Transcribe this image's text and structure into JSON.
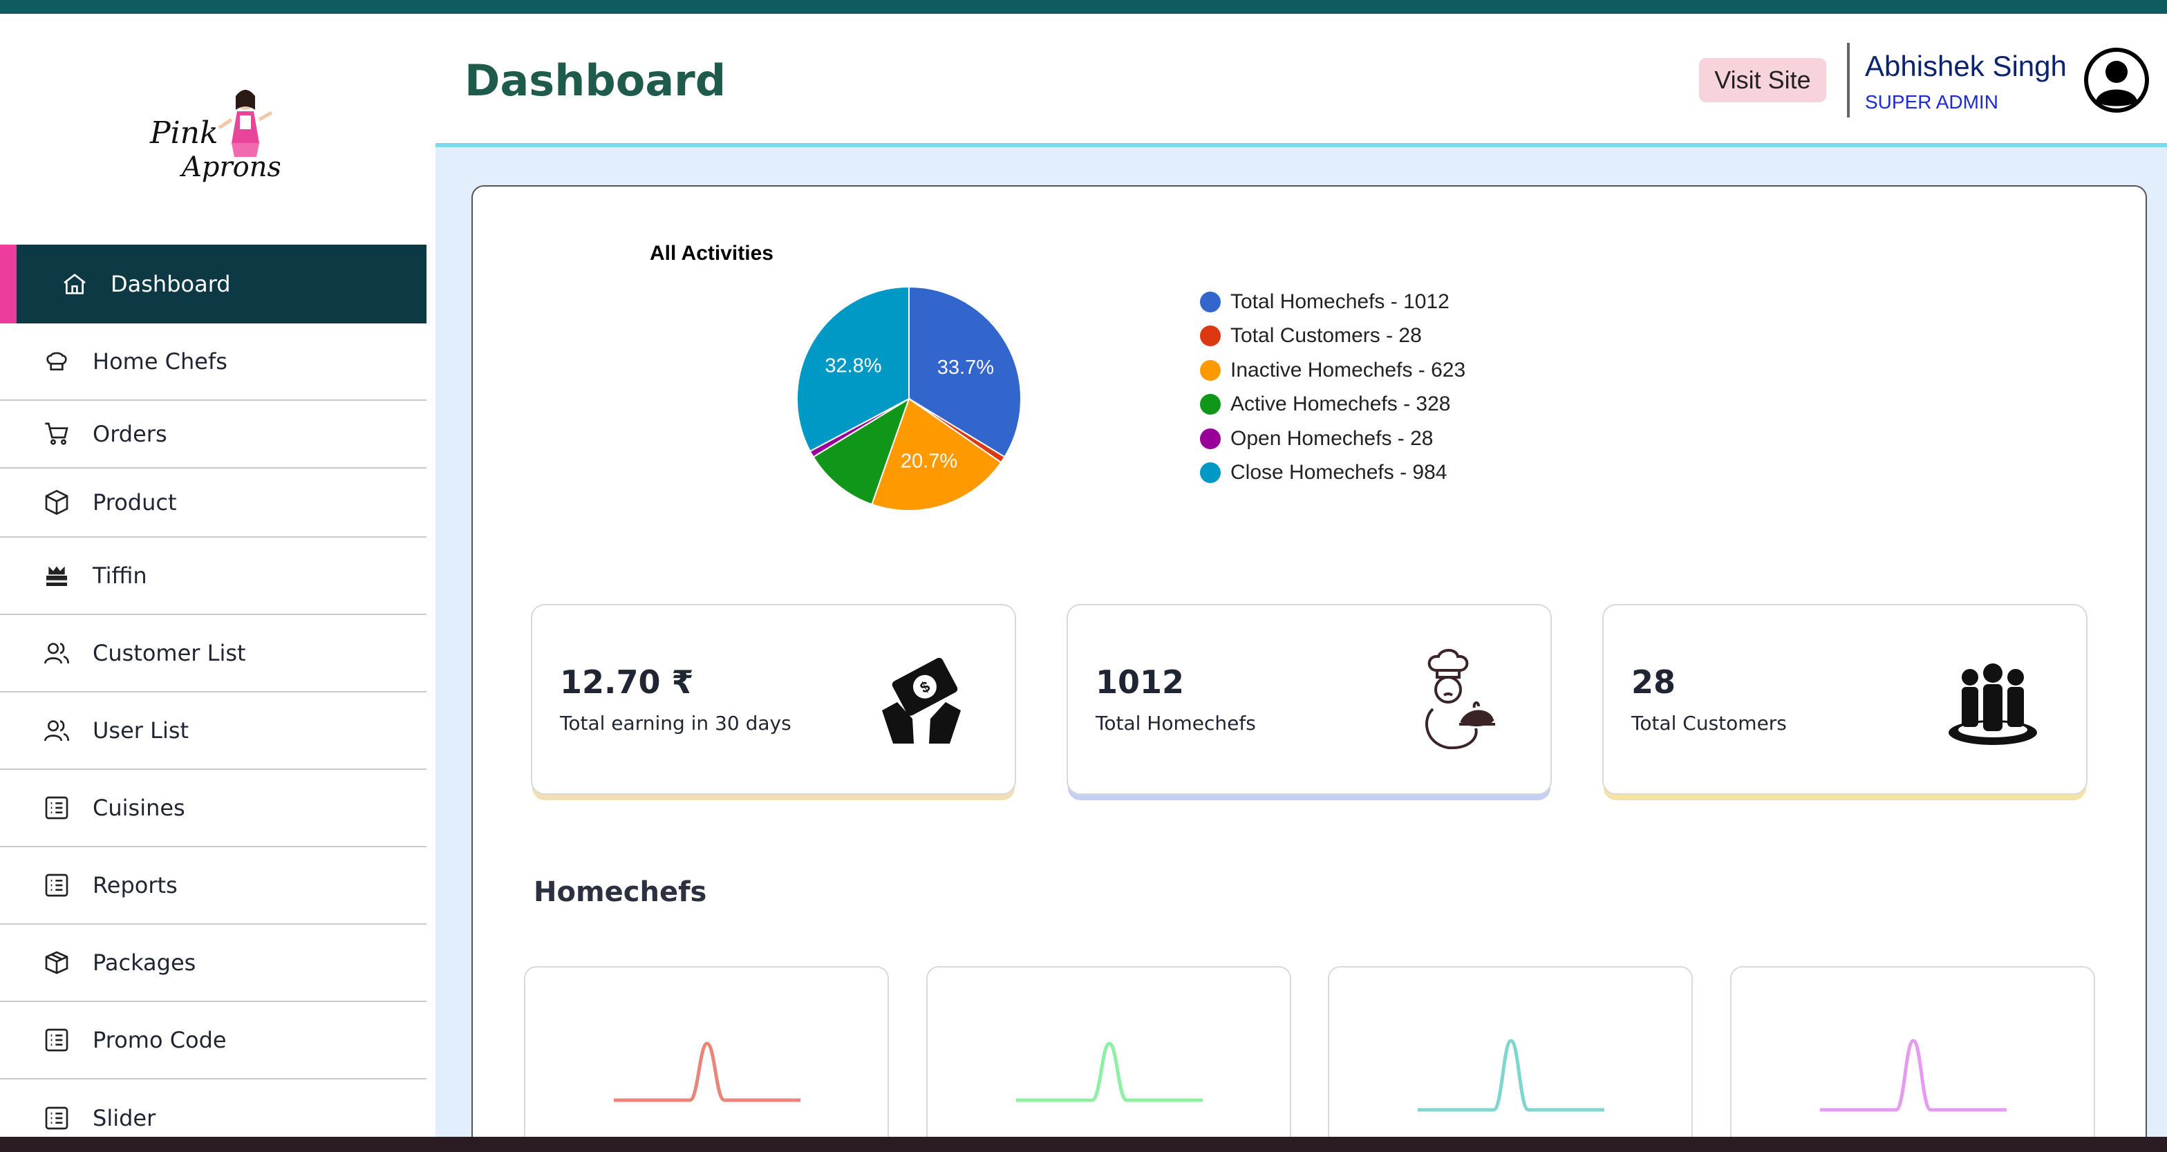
{
  "app": {
    "logo_text": "Pink Aprons",
    "accent_color": "#ec3d9c",
    "topbar_color": "#0f5c60",
    "sidebar_active_color": "#0c3944"
  },
  "header": {
    "title": "Dashboard",
    "visit_site_label": "Visit Site",
    "user_name": "Abhishek Singh",
    "user_role": "SUPER ADMIN",
    "avatar_icon": "user-circle-icon"
  },
  "sidebar": {
    "items": [
      {
        "label": "Dashboard",
        "icon": "home-icon",
        "active": true
      },
      {
        "label": "Home Chefs",
        "icon": "chef-hat-icon"
      },
      {
        "label": "Orders",
        "icon": "cart-icon"
      },
      {
        "label": "Product",
        "icon": "box-icon"
      },
      {
        "label": "Tiffin",
        "icon": "tiffin-icon"
      },
      {
        "label": "Customer List",
        "icon": "users-icon"
      },
      {
        "label": "User List",
        "icon": "users-icon"
      },
      {
        "label": "Cuisines",
        "icon": "list-icon"
      },
      {
        "label": "Reports",
        "icon": "list-icon"
      },
      {
        "label": "Packages",
        "icon": "package-icon"
      },
      {
        "label": "Promo Code",
        "icon": "list-icon"
      },
      {
        "label": "Slider",
        "icon": "list-icon"
      }
    ]
  },
  "chart_data": {
    "type": "pie",
    "title": "All Activities",
    "categories": [
      "Total Homechefs",
      "Total Customers",
      "Inactive Homechefs",
      "Active Homechefs",
      "Open Homechefs",
      "Close Homechefs"
    ],
    "values": [
      1012,
      28,
      623,
      328,
      28,
      984
    ],
    "colors": [
      "#3366cc",
      "#dc3912",
      "#ff9900",
      "#109618",
      "#990099",
      "#0099c6"
    ],
    "slice_labels": [
      "33.7%",
      "",
      "20.7%",
      "",
      "",
      "32.8%"
    ],
    "legend": [
      "Total Homechefs - 1012",
      "Total Customers - 28",
      "Inactive Homechefs - 623",
      "Active Homechefs - 328",
      "Open Homechefs - 28",
      "Close Homechefs - 984"
    ],
    "legend_placement": "right"
  },
  "stats": [
    {
      "value": "12.70 ₹",
      "label": "Total earning in 30 days",
      "icon": "money-hand-icon",
      "accent": "#f3dfb4"
    },
    {
      "value": "1012",
      "label": "Total Homechefs",
      "icon": "chef-icon",
      "accent": "#c3cff5"
    },
    {
      "value": "28",
      "label": "Total Customers",
      "icon": "people-group-icon",
      "accent": "#f5e2a8"
    }
  ],
  "homechefs": {
    "title": "Homechefs",
    "sparkline_colors": [
      "#e98679",
      "#8ef0a4",
      "#7fd6cf",
      "#e69af2"
    ]
  }
}
